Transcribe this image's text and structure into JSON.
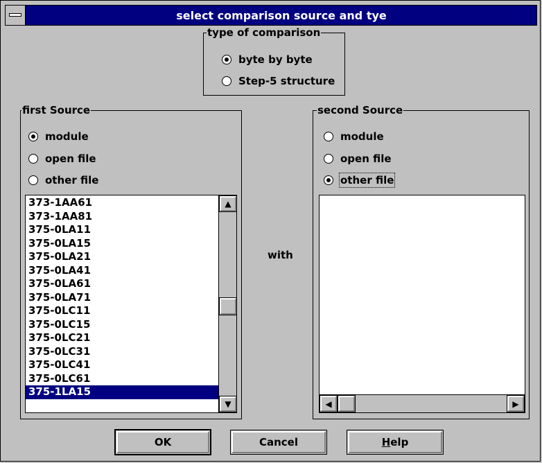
{
  "window": {
    "title": "select comparison source and tye"
  },
  "comparison_type": {
    "label": "type of comparison",
    "options": [
      {
        "label": "byte by byte",
        "checked": true
      },
      {
        "label": "Step-5 structure",
        "checked": false
      }
    ]
  },
  "first_source": {
    "label": "first Source",
    "options": [
      {
        "label": "module",
        "checked": true
      },
      {
        "label": "open file",
        "checked": false
      },
      {
        "label": "other file",
        "checked": false
      }
    ],
    "list_items": [
      "373-1AA61",
      "373-1AA81",
      "375-0LA11",
      "375-0LA15",
      "375-0LA21",
      "375-0LA41",
      "375-0LA61",
      "375-0LA71",
      "375-0LC11",
      "375-0LC15",
      "375-0LC21",
      "375-0LC31",
      "375-0LC41",
      "375-0LC61",
      "375-1LA15"
    ],
    "selected_item": "375-1LA15"
  },
  "with_label": "with",
  "second_source": {
    "label": "second Source",
    "options": [
      {
        "label": "module",
        "checked": false
      },
      {
        "label": "open file",
        "checked": false
      },
      {
        "label": "other file",
        "checked": true
      }
    ]
  },
  "buttons": {
    "ok": "OK",
    "cancel": "Cancel",
    "help_prefix": "H",
    "help_rest": "elp"
  }
}
